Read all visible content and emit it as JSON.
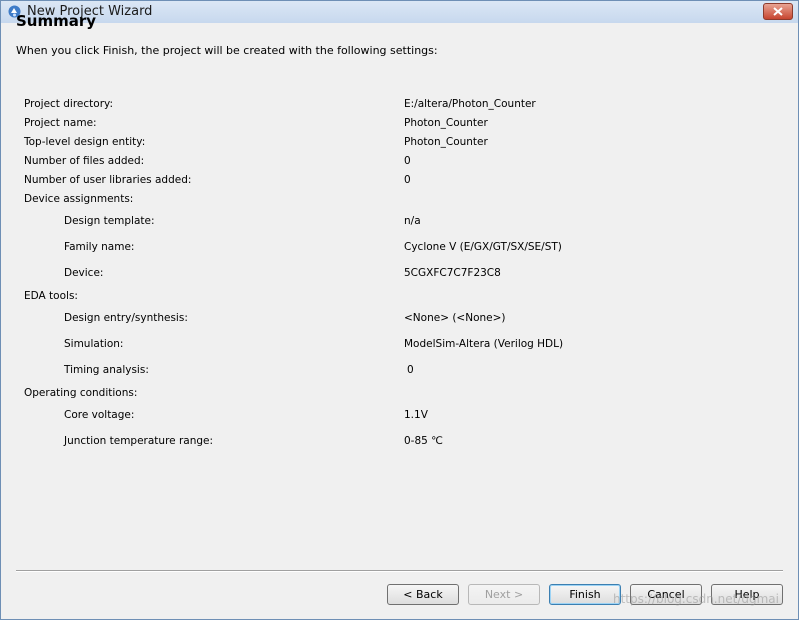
{
  "window": {
    "title": "New Project Wizard",
    "app_icon": "wizard-icon",
    "close_icon": "close-icon"
  },
  "page": {
    "heading": "Summary",
    "intro": "When you click Finish, the project will be created with the following settings:"
  },
  "settings": [
    {
      "label": "Project directory:",
      "value": "E:/altera/Photon_Counter"
    },
    {
      "label": "Project name:",
      "value": "Photon_Counter"
    },
    {
      "label": "Top-level design entity:",
      "value": "Photon_Counter"
    },
    {
      "label": "Number of files added:",
      "value": "0"
    },
    {
      "label": "Number of user libraries added:",
      "value": "0"
    },
    {
      "label": "Device assignments:",
      "value": ""
    },
    {
      "label": "Design template:",
      "value": "n/a"
    },
    {
      "label": "Family name:",
      "value": "Cyclone V (E/GX/GT/SX/SE/ST)"
    },
    {
      "label": "Device:",
      "value": "5CGXFC7C7F23C8"
    },
    {
      "label": "EDA tools:",
      "value": ""
    },
    {
      "label": "Design entry/synthesis:",
      "value": "<None> (<None>)"
    },
    {
      "label": "Simulation:",
      "value": "ModelSim-Altera (Verilog HDL)"
    },
    {
      "label": "Timing analysis:",
      "value": "0"
    },
    {
      "label": "Operating conditions:",
      "value": ""
    },
    {
      "label": "Core voltage:",
      "value": "1.1V"
    },
    {
      "label": "Junction temperature range:",
      "value": "0-85 ℃"
    }
  ],
  "buttons": {
    "back": "< Back",
    "next": "Next >",
    "finish": "Finish",
    "cancel": "Cancel",
    "help": "Help"
  },
  "watermark": "https://blog.csdn.net/dgmai"
}
